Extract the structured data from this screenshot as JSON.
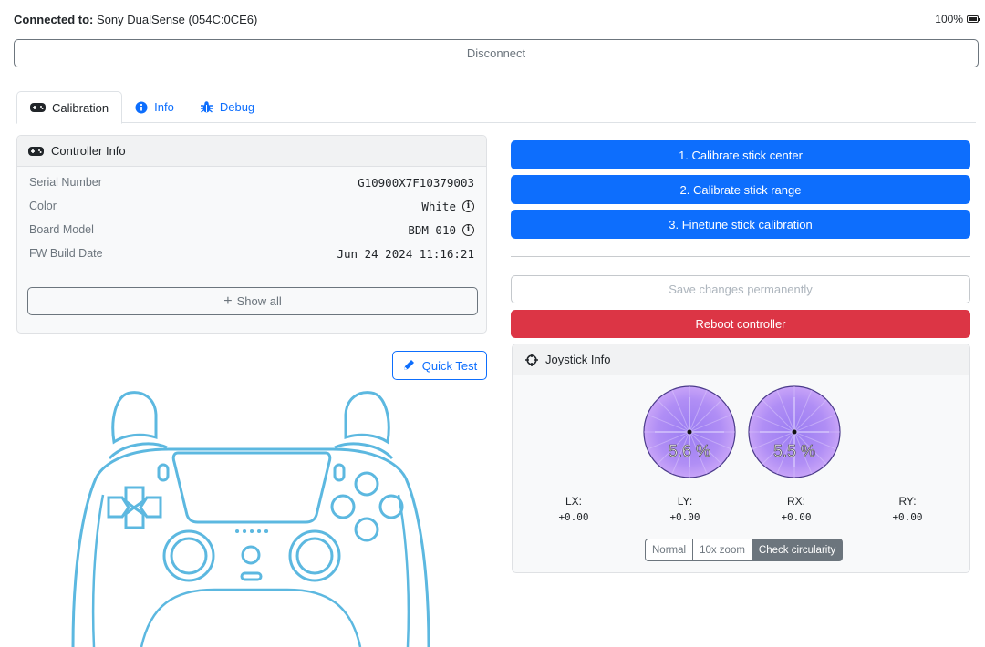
{
  "header": {
    "connected_label": "Connected to:",
    "device_name": "Sony DualSense (054C:0CE6)",
    "battery": "100%"
  },
  "disconnect_label": "Disconnect",
  "tabs": [
    {
      "label": "Calibration",
      "icon": "gamepad-icon",
      "active": true
    },
    {
      "label": "Info",
      "icon": "info-circle-icon",
      "active": false
    },
    {
      "label": "Debug",
      "icon": "bug-icon",
      "active": false
    }
  ],
  "controller_info": {
    "title": "Controller Info",
    "rows": [
      {
        "key": "Serial Number",
        "value": "G10900X7F10379003"
      },
      {
        "key": "Color",
        "value": "White"
      },
      {
        "key": "Board Model",
        "value": "BDM-010"
      },
      {
        "key": "FW Build Date",
        "value": "Jun 24 2024 11:16:21"
      }
    ],
    "show_all_label": "Show all"
  },
  "quick_test_label": "Quick Test",
  "actions": {
    "calibrate_center": "1. Calibrate stick center",
    "calibrate_range": "2. Calibrate stick range",
    "finetune": "3. Finetune stick calibration",
    "save": "Save changes permanently",
    "reboot": "Reboot controller"
  },
  "joystick_info": {
    "title": "Joystick Info",
    "left_stick_pct": "5.6 %",
    "right_stick_pct": "5.5 %",
    "axes": [
      {
        "label": "LX:",
        "value": "+0.00"
      },
      {
        "label": "LY:",
        "value": "+0.00"
      },
      {
        "label": "RX:",
        "value": "+0.00"
      },
      {
        "label": "RY:",
        "value": "+0.00"
      }
    ],
    "zoom_modes": [
      "Normal",
      "10x zoom",
      "Check circularity"
    ],
    "active_mode": "Check circularity"
  },
  "colors": {
    "primary": "#0d6efd",
    "danger": "#dc3545",
    "secondary": "#6c757d",
    "controller_outline": "#5cb8e0",
    "pad_purple": "#8a6ff0"
  }
}
